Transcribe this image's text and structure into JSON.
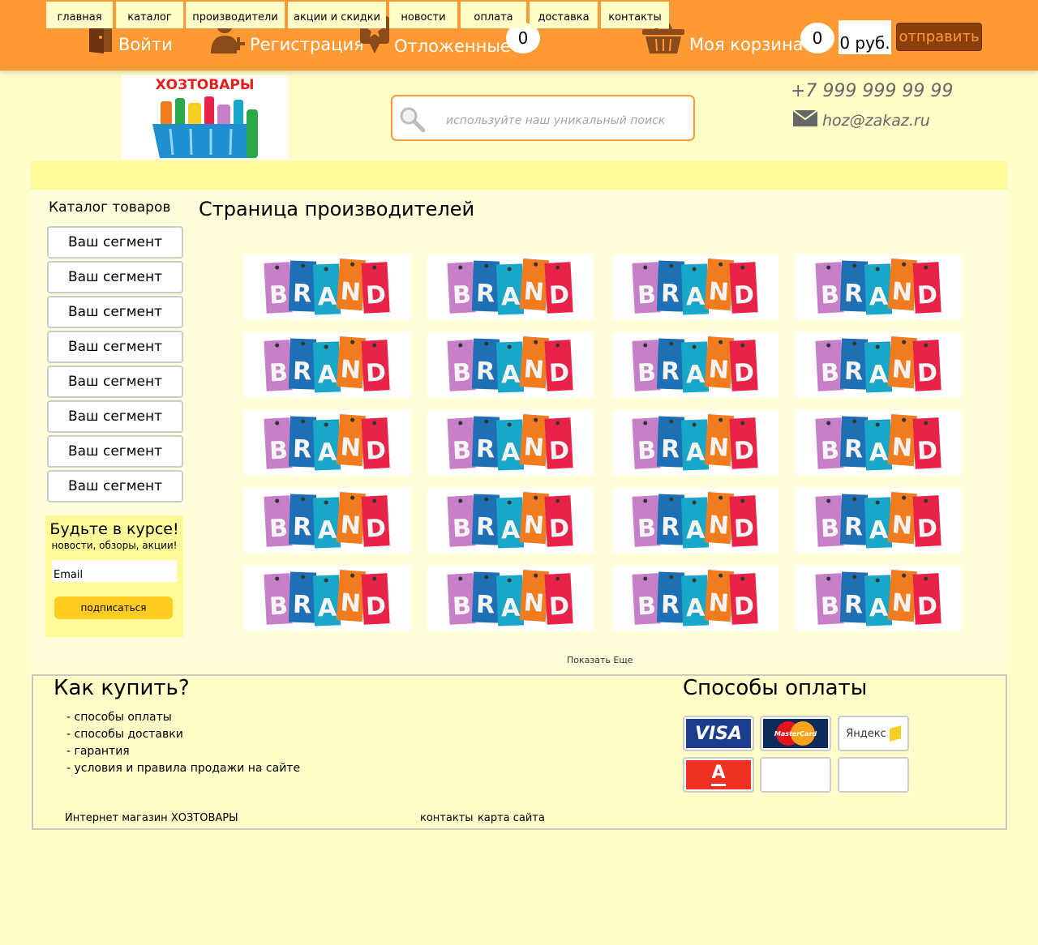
{
  "topbar": {
    "login_label": "Войти",
    "register_label": "Регистрация",
    "deferred_label": "Отложенные",
    "deferred_count": "0",
    "cart_label": "Моя корзина",
    "cart_count": "0",
    "cart_sum": "0 руб.",
    "send_label": "отправить"
  },
  "header": {
    "logo_text": "ХОЗТОВАРЫ",
    "search_placeholder": "используйте наш уникальный поиск",
    "phone": "+7 999 999 99 99",
    "email": "hoz@zakaz.ru"
  },
  "nav": {
    "items": [
      "главная",
      "каталог",
      "производители",
      "акции и скидки",
      "новости",
      "оплата",
      "доставка",
      "контакты"
    ]
  },
  "sidebar": {
    "catalog_title": "Каталог товаров",
    "segments": [
      "Ваш сегмент",
      "Ваш сегмент",
      "Ваш сегмент",
      "Ваш сегмент",
      "Ваш сегмент",
      "Ваш сегмент",
      "Ваш сегмент",
      "Ваш сегмент"
    ],
    "newsletter": {
      "title": "Будьте в курсе!",
      "subtitle": "новости, обзоры, акции!",
      "email_placeholder": "Email",
      "button": "подписаться"
    }
  },
  "main": {
    "title": "Страница производителей",
    "brand_label": "BRAND",
    "brand_letters": [
      "B",
      "R",
      "A",
      "N",
      "D"
    ],
    "brand_colors": [
      "#c77fc8",
      "#1f6fb5",
      "#19a7c9",
      "#f07c1f",
      "#e8234a"
    ],
    "show_more": "Показать Еще"
  },
  "footer": {
    "how_to_buy_title": "Как купить?",
    "how_to_buy_links": [
      "- способы оплаты",
      "- способы доставки",
      "- гарантия",
      "- условия и правила продажи на сайте"
    ],
    "payment_title": "Способы оплаты",
    "payment_methods": {
      "visa": "VISA",
      "mastercard": "MasterCard",
      "yandex": "Яндекс",
      "alfa": "А"
    },
    "shop_name": "Интернет магазин ХОЗТОВАРЫ",
    "contacts_link": "контакты",
    "sitemap_link": "карта сайта"
  },
  "colors": {
    "accent": "#ff9933",
    "background": "#fffdc8",
    "nav_bg": "#fffa99",
    "button_dark": "#8a3f0a",
    "subscribe_btn": "#ffcc22"
  }
}
